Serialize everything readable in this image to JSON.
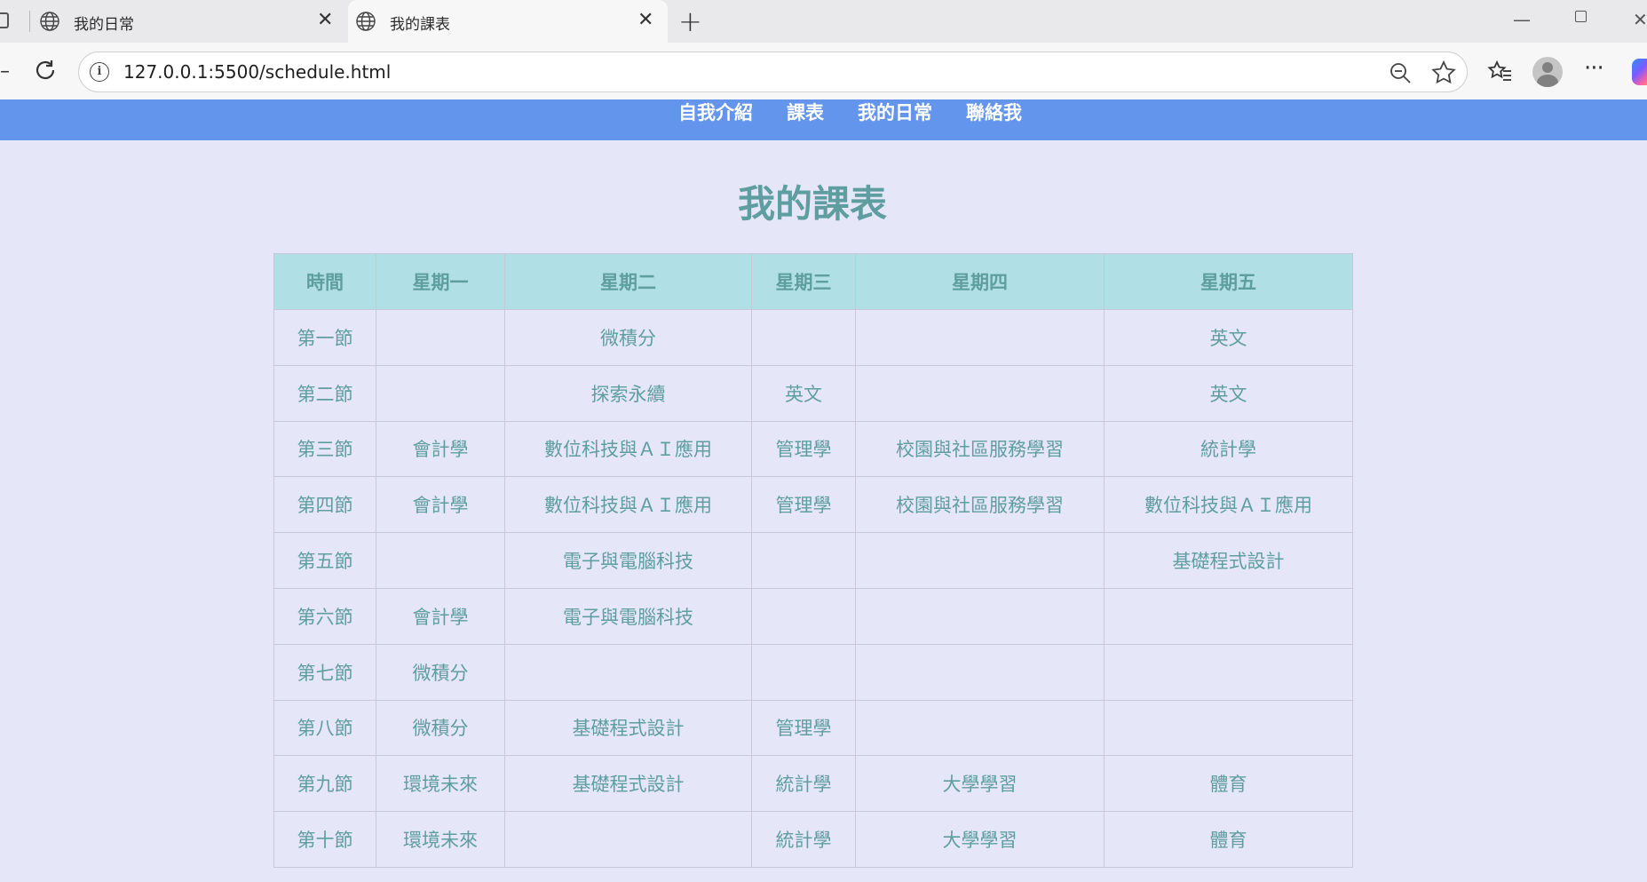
{
  "browser": {
    "tabs": [
      {
        "title": "我的日常",
        "active": false
      },
      {
        "title": "我的課表",
        "active": true
      }
    ],
    "url": "127.0.0.1:5500/schedule.html",
    "new_tab_label": "+",
    "close_label": "✕"
  },
  "nav": {
    "links": [
      "自我介紹",
      "課表",
      "我的日常",
      "聯絡我"
    ]
  },
  "page": {
    "title": "我的課表"
  },
  "schedule": {
    "headers": [
      "時間",
      "星期一",
      "星期二",
      "星期三",
      "星期四",
      "星期五"
    ],
    "rows": [
      [
        "第一節",
        "",
        "微積分",
        "",
        "",
        "英文"
      ],
      [
        "第二節",
        "",
        "探索永續",
        "英文",
        "",
        "英文"
      ],
      [
        "第三節",
        "會計學",
        "數位科技與ＡＩ應用",
        "管理學",
        "校園與社區服務學習",
        "統計學"
      ],
      [
        "第四節",
        "會計學",
        "數位科技與ＡＩ應用",
        "管理學",
        "校園與社區服務學習",
        "數位科技與ＡＩ應用"
      ],
      [
        "第五節",
        "",
        "電子與電腦科技",
        "",
        "",
        "基礎程式設計"
      ],
      [
        "第六節",
        "會計學",
        "電子與電腦科技",
        "",
        "",
        ""
      ],
      [
        "第七節",
        "微積分",
        "",
        "",
        "",
        ""
      ],
      [
        "第八節",
        "微積分",
        "基礎程式設計",
        "管理學",
        "",
        ""
      ],
      [
        "第九節",
        "環境未來",
        "基礎程式設計",
        "統計學",
        "大學學習",
        "體育"
      ],
      [
        "第十節",
        "環境未來",
        "",
        "統計學",
        "大學學習",
        "體育"
      ]
    ]
  },
  "colors": {
    "nav_bg": "#6495ed",
    "page_bg": "#e6e6f9",
    "accent_text": "#5f9ea0",
    "table_header_bg": "#b0dfe5"
  }
}
